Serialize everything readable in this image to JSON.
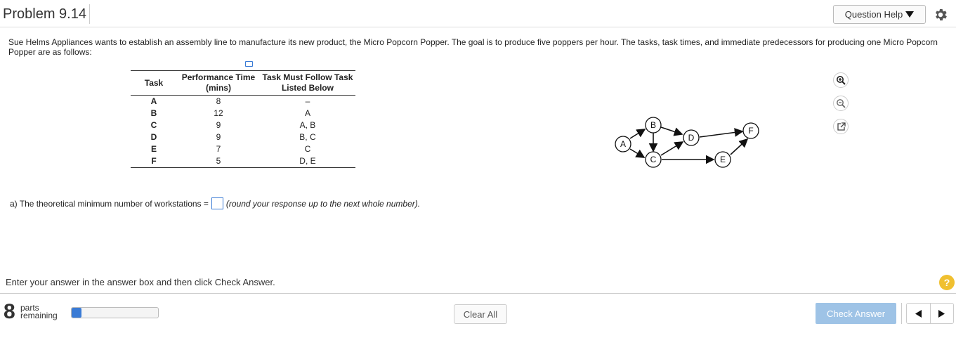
{
  "header": {
    "title": "Problem 9.14",
    "question_help_label": "Question Help",
    "icons": {
      "dropdown": "caret-down-icon",
      "settings": "gear-icon"
    }
  },
  "intro_text": "Sue Helms Appliances wants to establish an assembly line to manufacture its new product, the Micro Popcorn Popper. The goal is to produce five poppers per hour. The tasks, task times, and immediate predecessors for producing one Micro Popcorn Popper are as follows:",
  "table": {
    "headers": [
      "Task",
      "Performance Time (mins)",
      "Task Must Follow Task Listed Below"
    ],
    "rows": [
      {
        "task": "A",
        "time": "8",
        "predecessors": "–"
      },
      {
        "task": "B",
        "time": "12",
        "predecessors": "A"
      },
      {
        "task": "C",
        "time": "9",
        "predecessors": "A, B"
      },
      {
        "task": "D",
        "time": "9",
        "predecessors": "B, C"
      },
      {
        "task": "E",
        "time": "7",
        "predecessors": "C"
      },
      {
        "task": "F",
        "time": "5",
        "predecessors": "D, E"
      }
    ]
  },
  "diagram": {
    "nodes": [
      "A",
      "B",
      "C",
      "D",
      "E",
      "F"
    ]
  },
  "question": {
    "prefix": "a) The theoretical minimum number of workstations =",
    "answer_value": "",
    "hint": "(round your response up to the next whole number)."
  },
  "instruction": "Enter your answer in the answer box and then click Check Answer.",
  "footer": {
    "parts_count": "8",
    "parts_label_1": "parts",
    "parts_label_2": "remaining",
    "progress_fraction": 0.11,
    "clear_all_label": "Clear All",
    "check_answer_label": "Check Answer",
    "help_symbol": "?"
  },
  "colors": {
    "accent": "#3a7bd5",
    "check_button": "#9ec3e6",
    "help": "#f0c030"
  }
}
